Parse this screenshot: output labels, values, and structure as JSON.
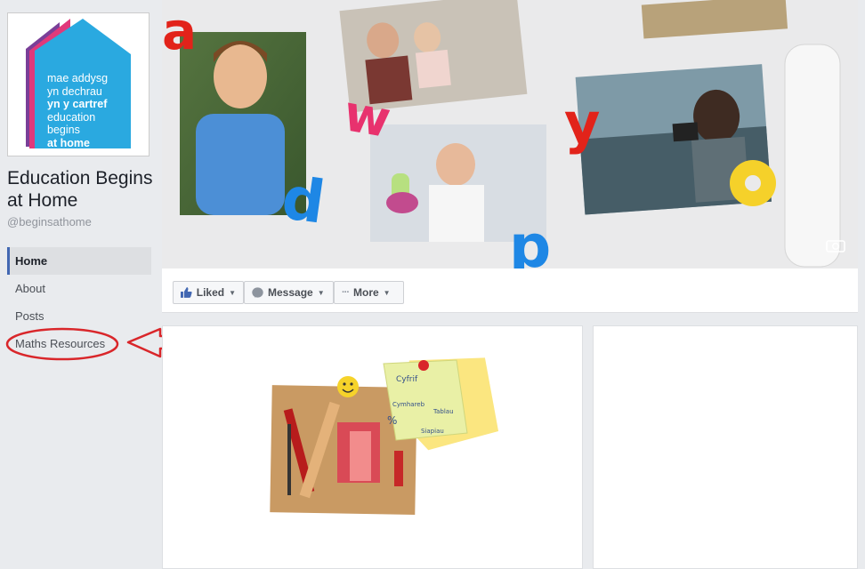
{
  "page": {
    "name": "Education Begins at Home",
    "handle": "@beginsathome"
  },
  "logo": {
    "lines": [
      "mae addysg",
      "yn dechrau",
      "yn y cartref",
      "education",
      "begins",
      "at home"
    ]
  },
  "nav": {
    "items": [
      {
        "label": "Home",
        "active": true
      },
      {
        "label": "About"
      },
      {
        "label": "Posts"
      },
      {
        "label": "Maths Resources"
      }
    ]
  },
  "actions": {
    "liked": "Liked",
    "message": "Message",
    "more": "More"
  },
  "cover": {
    "letters": [
      "a",
      "d",
      "w",
      "p",
      "y",
      "o"
    ]
  },
  "post": {
    "note_words": [
      "Cyfrif",
      "Tablau",
      "Cymhareb",
      "Siapiau",
      "%"
    ]
  },
  "colors": {
    "fb_blue": "#4267b2",
    "logo_blue": "#2aa9e0",
    "annotation_red": "#d9262a"
  }
}
